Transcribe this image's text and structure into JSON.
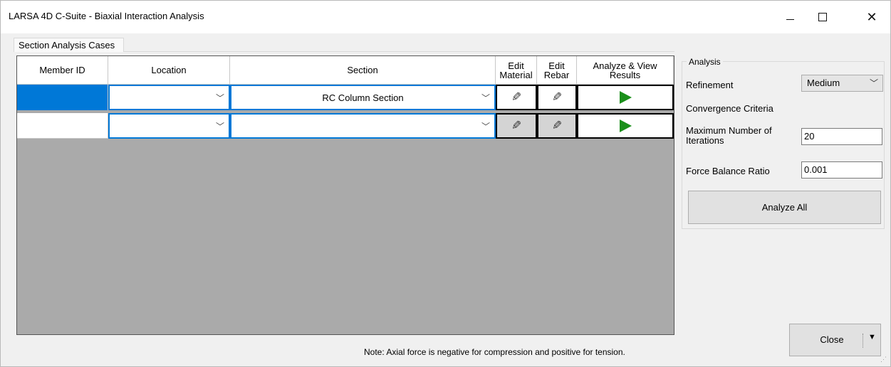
{
  "window": {
    "title": "LARSA 4D C-Suite - Biaxial Interaction Analysis"
  },
  "tab": {
    "label": "Section Analysis Cases"
  },
  "grid": {
    "headers": {
      "member_id": "Member ID",
      "location": "Location",
      "section": "Section",
      "edit_material": "Edit Material",
      "edit_rebar": "Edit Rebar",
      "analyze_view": "Analyze & View Results"
    },
    "rows": [
      {
        "member_id": "",
        "location": "",
        "section": "RC Column Section"
      },
      {
        "member_id": "",
        "location": "",
        "section": ""
      }
    ]
  },
  "note": "Note: Axial force is negative for compression and positive for tension.",
  "analysis": {
    "legend": "Analysis",
    "refinement_label": "Refinement",
    "refinement_value": "Medium",
    "convergence_label": "Convergence Criteria",
    "max_iter_label": "Maximum Number of Iterations",
    "max_iter_value": "20",
    "force_balance_label": "Force Balance Ratio",
    "force_balance_value": "0.001",
    "analyze_all": "Analyze All"
  },
  "footer": {
    "close": "Close"
  },
  "colors": {
    "selection": "#0078d7",
    "play": "#1a8f1a",
    "grid_bg": "#aaaaaa"
  },
  "icons": [
    "minimize-icon",
    "maximize-icon",
    "close-icon",
    "chevron-down-icon",
    "pencil-icon",
    "play-icon"
  ]
}
